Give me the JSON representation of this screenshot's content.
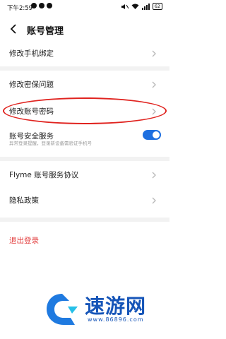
{
  "status": {
    "time": "下午2:59",
    "battery": "62"
  },
  "header": {
    "title": "账号管理"
  },
  "rows": [
    {
      "label": "修改手机绑定"
    },
    {
      "label": "修改密保问题"
    },
    {
      "label": "修改账号密码"
    },
    {
      "label": "账号安全服务",
      "desc": "异常登录提醒，登录新设备需验证手机号",
      "toggle_on": true
    },
    {
      "label": "Flyme 账号服务协议"
    },
    {
      "label": "隐私政策"
    }
  ],
  "logout_label": "退出登录",
  "watermark": {
    "name": "速游网",
    "url": "www.86896.com"
  },
  "colors": {
    "accent": "#1e6fe0",
    "danger": "#e23b3b",
    "highlight": "#e0231f",
    "watermark": "#1655b8"
  }
}
